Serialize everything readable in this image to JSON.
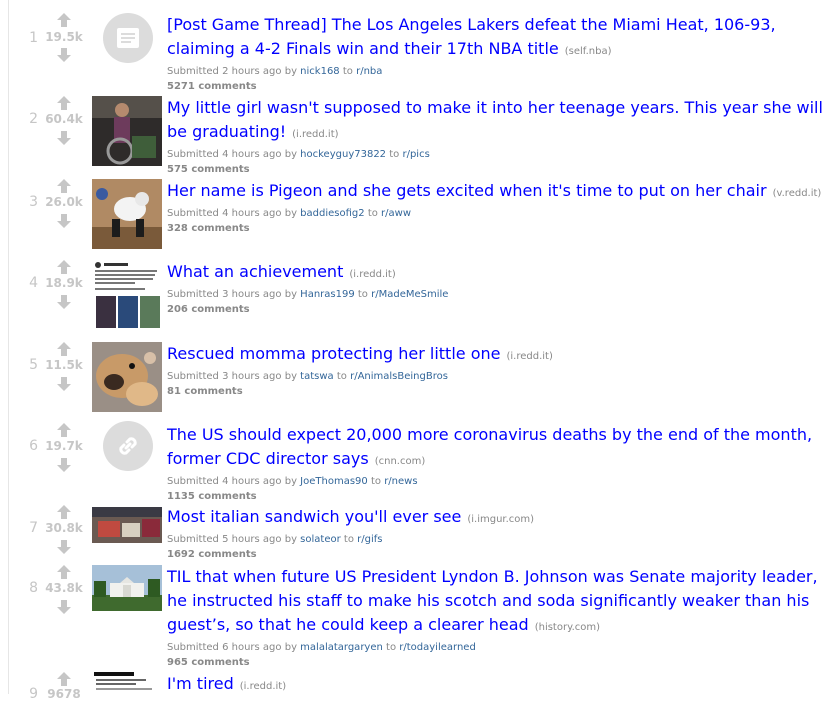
{
  "posts": [
    {
      "rank": "1",
      "score": "19.5k",
      "title": "[Post Game Thread] The Los Angeles Lakers defeat the Miami Heat, 106-93, claiming a 4-2 Finals win and their 17th NBA title",
      "domain": "(self.nba)",
      "submitted_prefix": "Submitted",
      "time": "2 hours ago",
      "by": "by",
      "author": "nick168",
      "to": "to",
      "subreddit": "r/nba",
      "comments": "5271 comments",
      "thumb": "self-post-icon"
    },
    {
      "rank": "2",
      "score": "60.4k",
      "title": "My little girl wasn't supposed to make it into her teenage years. This year she will be graduating!",
      "domain": "(i.redd.it)",
      "submitted_prefix": "Submitted",
      "time": "4 hours ago",
      "by": "by",
      "author": "hockeyguy73822",
      "to": "to",
      "subreddit": "r/pics",
      "comments": "575 comments",
      "thumb": "photo"
    },
    {
      "rank": "3",
      "score": "26.0k",
      "title": "Her name is Pigeon and she gets excited when it's time to put on her chair",
      "domain": "(v.redd.it)",
      "submitted_prefix": "Submitted",
      "time": "4 hours ago",
      "by": "by",
      "author": "baddiesofig2",
      "to": "to",
      "subreddit": "r/aww",
      "comments": "328 comments",
      "thumb": "photo"
    },
    {
      "rank": "4",
      "score": "18.9k",
      "title": "What an achievement",
      "domain": "(i.redd.it)",
      "submitted_prefix": "Submitted",
      "time": "3 hours ago",
      "by": "by",
      "author": "Hanras199",
      "to": "to",
      "subreddit": "r/MadeMeSmile",
      "comments": "206 comments",
      "thumb": "photo"
    },
    {
      "rank": "5",
      "score": "11.5k",
      "title": "Rescued momma protecting her little one",
      "domain": "(i.redd.it)",
      "submitted_prefix": "Submitted",
      "time": "3 hours ago",
      "by": "by",
      "author": "tatswa",
      "to": "to",
      "subreddit": "r/AnimalsBeingBros",
      "comments": "81 comments",
      "thumb": "photo"
    },
    {
      "rank": "6",
      "score": "19.7k",
      "title": "The US should expect 20,000 more coronavirus deaths by the end of the month, former CDC director says",
      "domain": "(cnn.com)",
      "submitted_prefix": "Submitted",
      "time": "4 hours ago",
      "by": "by",
      "author": "JoeThomas90",
      "to": "to",
      "subreddit": "r/news",
      "comments": "1135 comments",
      "thumb": "link-icon"
    },
    {
      "rank": "7",
      "score": "30.8k",
      "title": "Most italian sandwich you'll ever see",
      "domain": "(i.imgur.com)",
      "submitted_prefix": "Submitted",
      "time": "5 hours ago",
      "by": "by",
      "author": "solateor",
      "to": "to",
      "subreddit": "r/gifs",
      "comments": "1692 comments",
      "thumb": "photo"
    },
    {
      "rank": "8",
      "score": "43.8k",
      "title": "TIL that when future US President Lyndon B. Johnson was Senate majority leader, he instructed his staff to make his scotch and soda significantly weaker than his guest’s, so that he could keep a clearer head",
      "domain": "(history.com)",
      "submitted_prefix": "Submitted",
      "time": "6 hours ago",
      "by": "by",
      "author": "malalatargaryen",
      "to": "to",
      "subreddit": "r/todayilearned",
      "comments": "965 comments",
      "thumb": "photo"
    },
    {
      "rank": "9",
      "score": "9678",
      "title": "I'm tired",
      "domain": "(i.redd.it)",
      "thumb": "photo"
    }
  ],
  "colors": {
    "link": "#0000ff",
    "meta": "#888888",
    "author_link": "#336699",
    "vote_arrow": "#c6c6c6"
  }
}
